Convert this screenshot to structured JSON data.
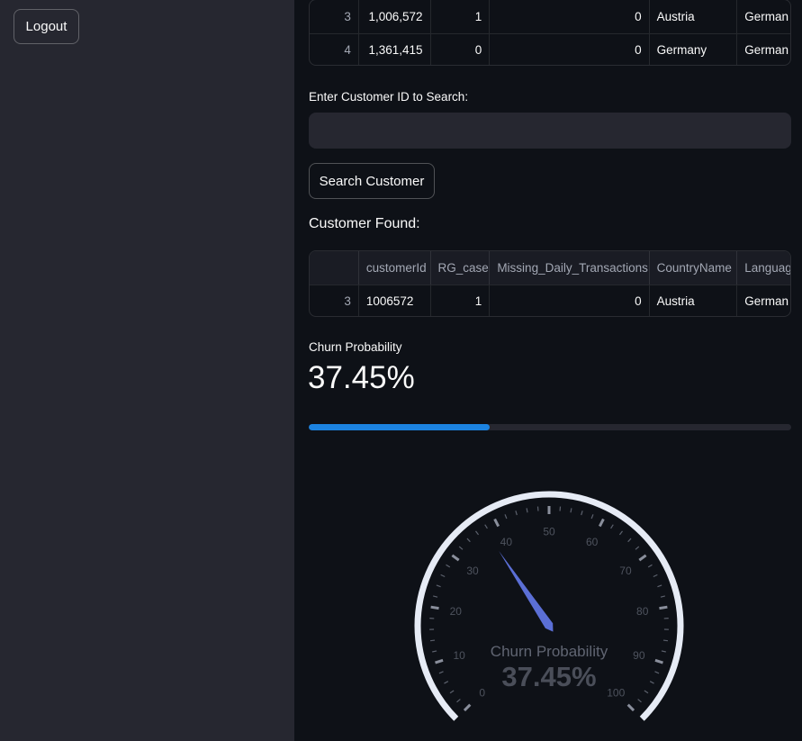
{
  "sidebar": {
    "logout_label": "Logout"
  },
  "top_table": {
    "rows": [
      {
        "index": "3",
        "customerId": "1,006,572",
        "RG_case": "1",
        "Missing_Daily_Transactions": "0",
        "CountryName": "Austria",
        "Language": "German"
      },
      {
        "index": "4",
        "customerId": "1,361,415",
        "RG_case": "0",
        "Missing_Daily_Transactions": "0",
        "CountryName": "Germany",
        "Language": "German"
      }
    ]
  },
  "search": {
    "label": "Enter Customer ID to Search:",
    "value": "",
    "placeholder": "",
    "button_label": "Search Customer"
  },
  "result": {
    "title": "Customer Found:",
    "headers": [
      "",
      "customerId",
      "RG_case",
      "Missing_Daily_Transactions",
      "CountryName",
      "Languag"
    ],
    "row": {
      "index": "3",
      "customerId": "1006572",
      "RG_case": "1",
      "Missing_Daily_Transactions": "0",
      "CountryName": "Austria",
      "Language": "German"
    }
  },
  "metric": {
    "label": "Churn Probability",
    "value": "37.45%",
    "progress": 0.3745
  },
  "gauge": {
    "title": "Churn Probability",
    "value_text": "37.45%",
    "value": 37.45,
    "min": 0,
    "max": 100,
    "tick_labels": [
      "0",
      "10",
      "20",
      "30",
      "40",
      "50",
      "60",
      "70",
      "80",
      "90",
      "100"
    ],
    "needle_color": "#5b6fd6",
    "arc_color": "#e6ebf5"
  },
  "colors": {
    "background": "#0e1117",
    "sidebar": "#262730",
    "accent": "#1c83e1"
  }
}
